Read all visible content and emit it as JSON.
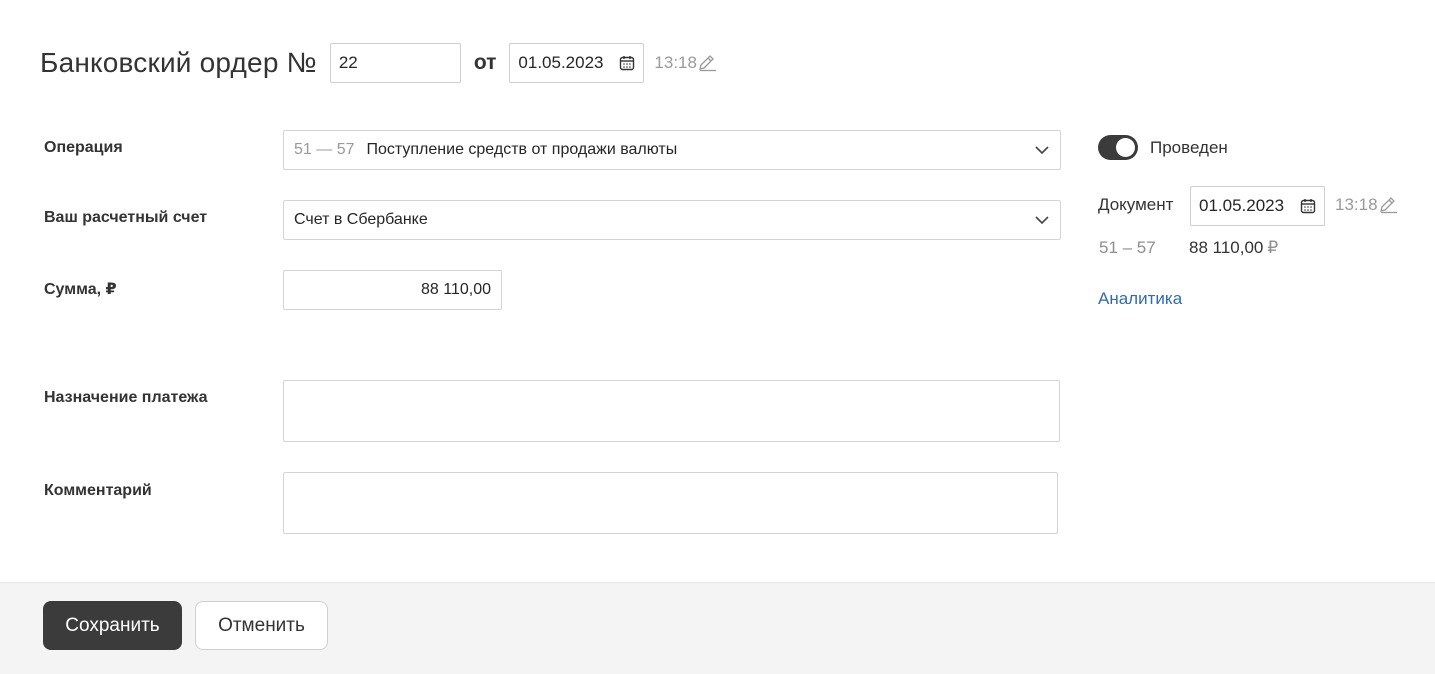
{
  "header": {
    "title": "Банковский ордер №",
    "number": "22",
    "from_label": "от",
    "date": "01.05.2023",
    "time": "13:18"
  },
  "form": {
    "operation": {
      "label": "Операция",
      "code": "51 — 57",
      "value": "Поступление средств от продажи валюты"
    },
    "account": {
      "label": "Ваш расчетный счет",
      "value": "Счет в Сбербанке"
    },
    "sum": {
      "label": "Сумма, ₽",
      "value": "88 110,00"
    },
    "purpose": {
      "label": "Назначение платежа",
      "value": ""
    },
    "comment": {
      "label": "Комментарий",
      "value": ""
    }
  },
  "side": {
    "posted_label": "Проведен",
    "posted": true,
    "document_label": "Документ",
    "document_date": "01.05.2023",
    "document_time": "13:18",
    "accounts": "51 – 57",
    "amount": "88 110,00",
    "currency": "₽",
    "analytics_link": "Аналитика"
  },
  "footer": {
    "save_label": "Сохранить",
    "cancel_label": "Отменить"
  },
  "colors": {
    "primary_dark": "#3b3b3b",
    "link": "#2f6bb3",
    "muted": "#9a9a9a"
  }
}
